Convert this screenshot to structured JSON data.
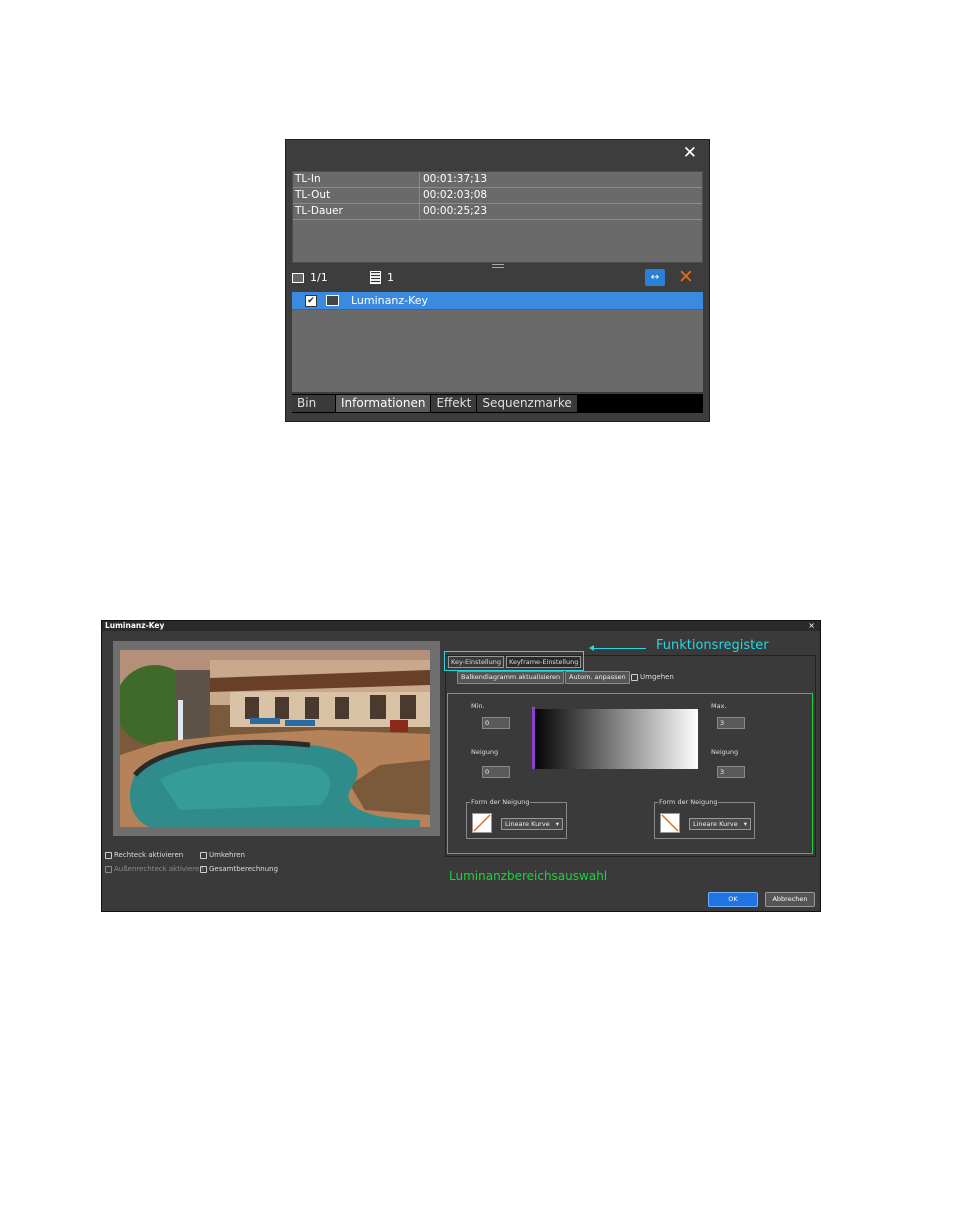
{
  "info_palette": {
    "close_glyph": "✕",
    "rows": [
      {
        "key": "TL-In",
        "value": "00:01:37;13"
      },
      {
        "key": "TL-Out",
        "value": "00:02:03;08"
      },
      {
        "key": "TL-Dauer",
        "value": "00:00:25;23"
      }
    ],
    "toolbar": {
      "track_count": "1/1",
      "effect_count": "1",
      "delete_glyph": "✕",
      "replace_glyph": "↔"
    },
    "effects": [
      {
        "label": "Luminanz-Key",
        "checked": true
      }
    ],
    "tabs": [
      "Bin",
      "Informationen",
      "Effekt",
      "Sequenzmarke"
    ],
    "active_tab": "Informationen"
  },
  "dialog": {
    "title": "Luminanz-Key",
    "close_glyph": "×",
    "checkboxes": {
      "rechteck": "Rechteck aktivieren",
      "umkehren": "Umkehren",
      "aussenrechteck": "Außenrechteck aktivieren",
      "gesamt": "Gesamtberechnung"
    },
    "tabs": [
      "Key-Einstellung",
      "Keyframe-Einstellung"
    ],
    "funktionsregister_label": "Funktionsregister",
    "buttons": {
      "balken": "Balkendiagramm aktualisieren",
      "autom": "Autom. anpassen",
      "umgehen": "Umgehen"
    },
    "min_label": "Min.",
    "min_value": "0",
    "max_label": "Max.",
    "max_value": "3",
    "neigung_left_label": "Neigung",
    "neigung_left_value": "0",
    "neigung_right_label": "Neigung",
    "neigung_right_value": "3",
    "form_left_title": "Form der Neigung",
    "form_left_select": "Lineare Kurve",
    "form_right_title": "Form der Neigung",
    "form_right_select": "Lineare Kurve",
    "luminanz_label": "Luminanzbereichsauswahl",
    "ok": "OK",
    "cancel": "Abbrechen",
    "colors": {
      "cyan_annotation": "#27d6e3",
      "green_annotation": "#1ed33a",
      "ok_blue": "#1f74e0"
    }
  }
}
